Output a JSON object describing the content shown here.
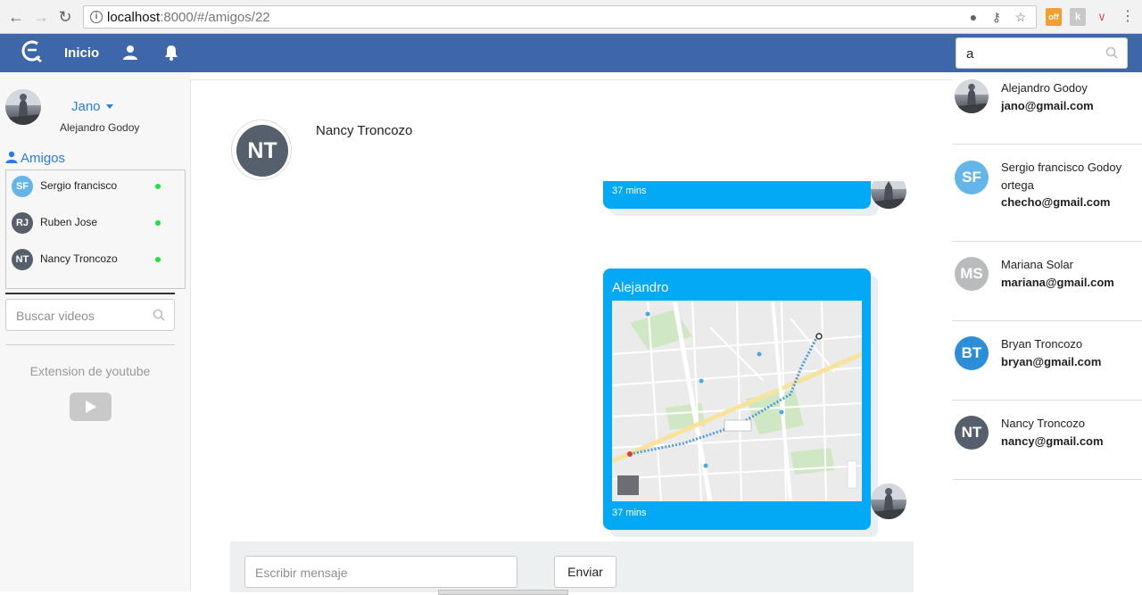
{
  "browser": {
    "url_host": "localhost",
    "url_port_path": ":8000/#/amigos/22",
    "extension_badge": "off"
  },
  "navbar": {
    "home_label": "Inicio",
    "search_value": "a"
  },
  "me": {
    "short_name": "Jano",
    "full_name": "Alejandro Godoy"
  },
  "friends": {
    "title": "Amigos",
    "items": [
      {
        "initials": "SF",
        "name": "Sergio francisco",
        "color": "#64b5e9",
        "online": true
      },
      {
        "initials": "RJ",
        "name": "Ruben Jose",
        "color": "#565f6c",
        "online": true
      },
      {
        "initials": "NT",
        "name": "Nancy Troncozo",
        "color": "#565f6c",
        "online": true
      }
    ]
  },
  "videos": {
    "search_placeholder": "Buscar videos",
    "extension_title": "Extension de youtube"
  },
  "chat": {
    "contact_initials": "NT",
    "contact_name": "Nancy Troncozo",
    "messages": [
      {
        "author": "",
        "time": "37 mins",
        "type": "text"
      },
      {
        "author": "Alejandro",
        "time": "37 mins",
        "type": "map"
      }
    ],
    "input_placeholder": "Escribir mensaje",
    "send_label": "Enviar"
  },
  "results": {
    "items": [
      {
        "initials": "",
        "name": "Alejandro Godoy",
        "email": "jano@gmail.com",
        "color": "photo"
      },
      {
        "initials": "SF",
        "name": "Sergio francisco Godoy ortega",
        "email": "checho@gmail.com",
        "color": "#64b5e9"
      },
      {
        "initials": "MS",
        "name": "Mariana Solar",
        "email": "mariana@gmail.com",
        "color": "#b9bbbd"
      },
      {
        "initials": "BT",
        "name": "Bryan Troncozo",
        "email": "bryan@gmail.com",
        "color": "#2b8ed6"
      },
      {
        "initials": "NT",
        "name": "Nancy Troncozo",
        "email": "nancy@gmail.com",
        "color": "#565f6c"
      }
    ]
  },
  "colors": {
    "navbar": "#3d67a8",
    "bubble": "#03a9f4",
    "link": "#2a7de1",
    "online": "#19e53a"
  }
}
